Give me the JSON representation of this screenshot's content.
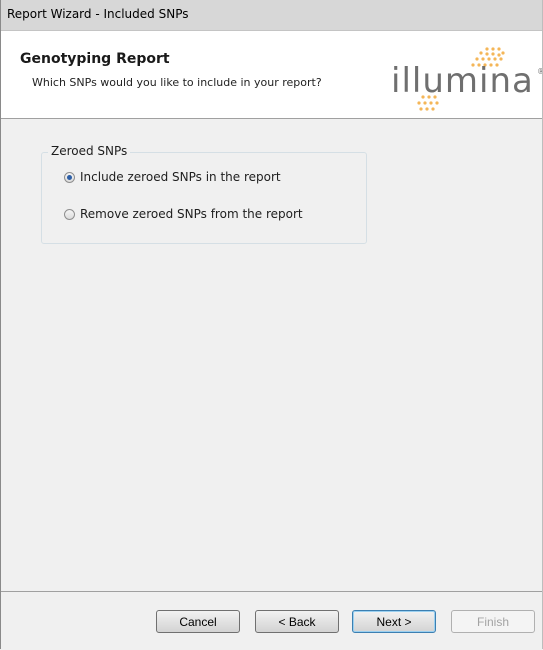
{
  "window": {
    "title": "Report Wizard - Included SNPs"
  },
  "header": {
    "title": "Genotyping Report",
    "subtitle": "Which SNPs would you like to include in your report?",
    "logo_text": "illumina",
    "logo_reg": "®",
    "logo_dot_color": "#f2a93b"
  },
  "group": {
    "legend": "Zeroed SNPs",
    "options": [
      {
        "label": "Include zeroed SNPs in the report",
        "selected": true
      },
      {
        "label": "Remove zeroed SNPs from the report",
        "selected": false
      }
    ]
  },
  "buttons": {
    "cancel": "Cancel",
    "back": "< Back",
    "next": "Next >",
    "finish": "Finish"
  }
}
